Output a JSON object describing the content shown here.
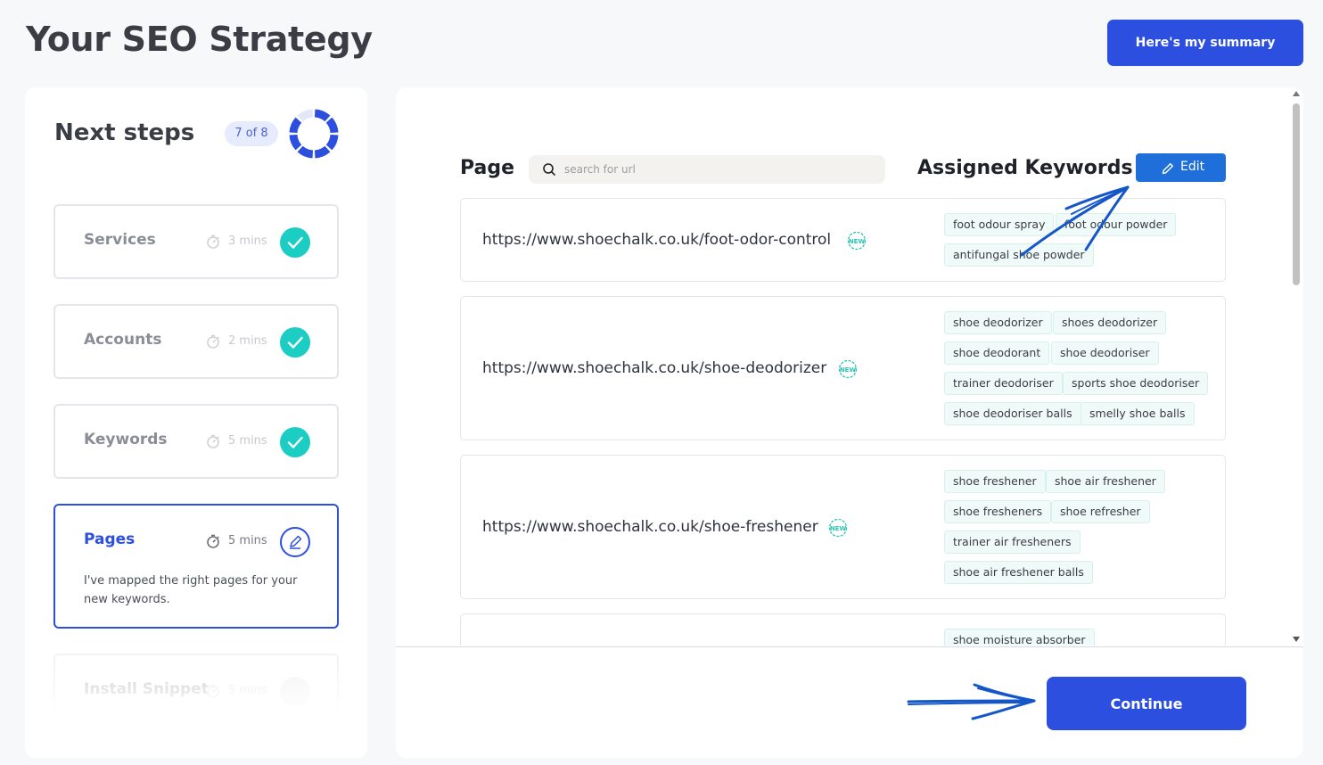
{
  "header": {
    "title": "Your SEO Strategy",
    "summary_label": "Here's my summary"
  },
  "next_steps": {
    "title": "Next steps",
    "progress_label": "7 of 8",
    "progress_fraction": 0.875,
    "steps": [
      {
        "name": "Services",
        "mins": "3 mins",
        "status": "done"
      },
      {
        "name": "Accounts",
        "mins": "2 mins",
        "status": "done"
      },
      {
        "name": "Keywords",
        "mins": "5 mins",
        "status": "done"
      },
      {
        "name": "Pages",
        "mins": "5 mins",
        "status": "active",
        "description": "I've mapped the right pages for your new keywords."
      },
      {
        "name": "Install Snippet",
        "mins": "5 mins",
        "status": "pending"
      }
    ]
  },
  "pages_table": {
    "page_header": "Page",
    "search_placeholder": "search for url",
    "keywords_header": "Assigned Keywords",
    "edit_label": "Edit",
    "new_badge": "NEW",
    "rows": [
      {
        "url": "https://www.shoechalk.co.uk/foot-odor-control",
        "keywords": [
          "foot odour spray",
          "foot odour powder",
          "antifungal shoe powder"
        ]
      },
      {
        "url": "https://www.shoechalk.co.uk/shoe-deodorizer",
        "keywords": [
          "shoe deodorizer",
          "shoes deodorizer",
          "shoe deodorant",
          "shoe deodoriser",
          "trainer deodoriser",
          "sports shoe deodoriser",
          "shoe deodoriser balls",
          "smelly shoe balls"
        ]
      },
      {
        "url": "https://www.shoechalk.co.uk/shoe-freshener",
        "keywords": [
          "shoe freshener",
          "shoe air freshener",
          "shoe fresheners",
          "shoe refresher",
          "trainer air fresheners",
          "shoe air freshener balls"
        ]
      },
      {
        "url": "",
        "keywords": [
          "shoe moisture absorber"
        ]
      }
    ]
  },
  "footer": {
    "continue_label": "Continue"
  },
  "colors": {
    "primary": "#2d4fe0",
    "edit_blue": "#1e6fd9",
    "teal": "#1ccdc4",
    "annotation": "#1556c9"
  }
}
